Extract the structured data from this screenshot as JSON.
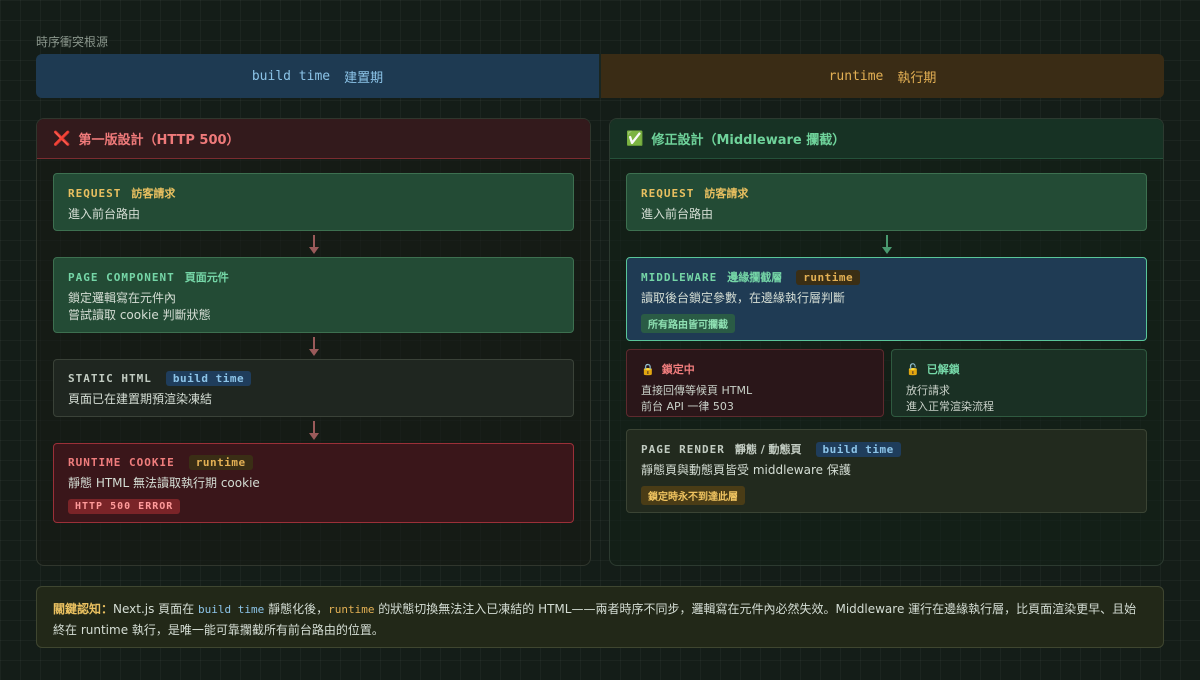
{
  "section_title": "時序衝突根源",
  "timeline": {
    "build_code": "build time",
    "build_label": "建置期",
    "runtime_code": "runtime",
    "runtime_label": "執行期"
  },
  "left_panel": {
    "icon": "cross-mark-icon",
    "title": "第一版設計（HTTP 500）",
    "steps": [
      {
        "code": "REQUEST",
        "zh": "訪客請求",
        "lines": [
          "進入前台路由"
        ]
      },
      {
        "code": "PAGE COMPONENT",
        "zh": "頁面元件",
        "lines": [
          "鎖定邏輯寫在元件內",
          "嘗試讀取 cookie 判斷狀態"
        ]
      },
      {
        "code": "STATIC HTML",
        "badge": "build time",
        "lines": [
          "頁面已在建置期預渲染凍結"
        ]
      },
      {
        "code": "RUNTIME COOKIE",
        "badge": "runtime",
        "lines": [
          "靜態 HTML 無法讀取執行期 cookie"
        ],
        "pill": "HTTP 500 ERROR"
      }
    ]
  },
  "right_panel": {
    "icon": "check-mark-icon",
    "title": "修正設計（Middleware 攔截）",
    "request": {
      "code": "REQUEST",
      "zh": "訪客請求",
      "lines": [
        "進入前台路由"
      ]
    },
    "middleware": {
      "code": "MIDDLEWARE",
      "zh": "邊緣攔截層",
      "badge": "runtime",
      "lines": [
        "讀取後台鎖定參數，在邊緣執行層判斷"
      ],
      "pill": "所有路由皆可攔截"
    },
    "locked": {
      "icon": "lock-icon",
      "title": "鎖定中",
      "lines": [
        "直接回傳等候頁 HTML",
        "前台 API 一律 503"
      ]
    },
    "unlocked": {
      "icon": "unlock-icon",
      "title": "已解鎖",
      "lines": [
        "放行請求",
        "進入正常渲染流程"
      ]
    },
    "render": {
      "code": "PAGE RENDER",
      "zh": "靜態 / 動態頁",
      "badge": "build time",
      "lines": [
        "靜態頁與動態頁皆受 middleware 保護"
      ],
      "pill": "鎖定時永不到達此層"
    }
  },
  "note": {
    "keyword": "關鍵認知：",
    "p1": "Next.js 頁面在 ",
    "code1": "build time",
    "p2": " 靜態化後，",
    "code2": "runtime",
    "p3": " 的狀態切換無法注入已凍結的 HTML——兩者時序不同步，邏輯寫在元件內必然失效。Middleware 運行在邊緣執行層，比頁面渲染更早、且始終在 runtime 執行，是唯一能可靠攔截所有前台路由的位置。"
  },
  "colors": {
    "build": "#8cc4e8",
    "runtime": "#e3b054",
    "error": "#ef7a7a",
    "ok": "#6fd39b"
  }
}
